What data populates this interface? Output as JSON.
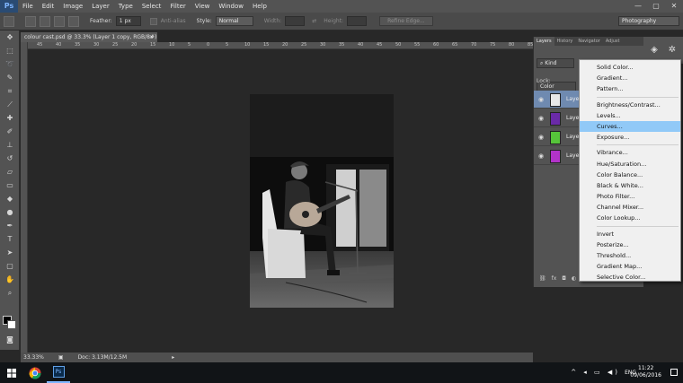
{
  "app": {
    "logo": "Ps"
  },
  "menubar": {
    "items": [
      "File",
      "Edit",
      "Image",
      "Layer",
      "Type",
      "Select",
      "Filter",
      "View",
      "Window",
      "Help"
    ],
    "controls": [
      "—",
      "▢",
      "✕"
    ]
  },
  "options": {
    "feather_label": "Feather:",
    "feather_value": "1 px",
    "antialias_label": "Anti-alias",
    "style_label": "Style:",
    "style_value": "Normal",
    "width_label": "Width:",
    "height_label": "Height:",
    "refine_edge_label": "Refine Edge...",
    "workspace_value": "Photography"
  },
  "document": {
    "tab_title": "colour cast.psd @ 33.3% (Layer 1 copy, RGB/8#)",
    "tab_close": "×",
    "ruler_ticks": [
      "45",
      "40",
      "35",
      "30",
      "25",
      "20",
      "15",
      "10",
      "5",
      "0",
      "5",
      "10",
      "15",
      "20",
      "25",
      "30",
      "35",
      "40",
      "45",
      "50",
      "55",
      "60",
      "65",
      "70",
      "75",
      "80",
      "85"
    ]
  },
  "status": {
    "zoom": "33.33%",
    "doc_info": "Doc: 3.13M/12.5M"
  },
  "layers_panel": {
    "tabs": [
      "Layers",
      "History",
      "Navigator",
      "Adjust"
    ],
    "kind_label": "Kind",
    "blend_label": "Color",
    "lock_label": "Lock:",
    "layers": [
      {
        "name": "Layer",
        "selected": true,
        "thumb": "#e8e8e8"
      },
      {
        "name": "Layer",
        "selected": false,
        "thumb": "#6a2aa8"
      },
      {
        "name": "Layer",
        "selected": false,
        "thumb": "#56c43a"
      },
      {
        "name": "Layer",
        "selected": false,
        "thumb": "#b233c9"
      }
    ],
    "footer_icons": [
      "link-icon",
      "fx-icon",
      "mask-icon",
      "adjustment-icon",
      "folder-icon",
      "new-layer-icon",
      "trash-icon"
    ]
  },
  "adjustment_menu": {
    "items": [
      {
        "label": "Solid Color...",
        "group": 1
      },
      {
        "label": "Gradient...",
        "group": 1
      },
      {
        "label": "Pattern...",
        "group": 1
      },
      {
        "label": "Brightness/Contrast...",
        "group": 2
      },
      {
        "label": "Levels...",
        "group": 2
      },
      {
        "label": "Curves...",
        "group": 2,
        "highlighted": true
      },
      {
        "label": "Exposure...",
        "group": 2
      },
      {
        "label": "Vibrance...",
        "group": 3
      },
      {
        "label": "Hue/Saturation...",
        "group": 3
      },
      {
        "label": "Color Balance...",
        "group": 3
      },
      {
        "label": "Black & White...",
        "group": 3
      },
      {
        "label": "Photo Filter...",
        "group": 3
      },
      {
        "label": "Channel Mixer...",
        "group": 3
      },
      {
        "label": "Color Lookup...",
        "group": 3
      },
      {
        "label": "Invert",
        "group": 4
      },
      {
        "label": "Posterize...",
        "group": 4
      },
      {
        "label": "Threshold...",
        "group": 4
      },
      {
        "label": "Gradient Map...",
        "group": 4
      },
      {
        "label": "Selective Color...",
        "group": 4
      }
    ]
  },
  "taskbar": {
    "time": "11:22",
    "date": "09/06/2016",
    "lang": "ENG",
    "tray": "^ ◂ ▭ ◀)"
  },
  "colors": {
    "accent": "#91c9f7",
    "selected_layer": "#6f8ab0",
    "panel": "#535353"
  }
}
